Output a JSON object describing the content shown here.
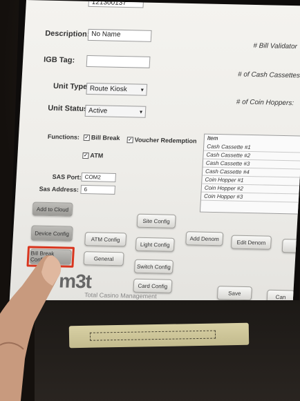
{
  "form": {
    "unit_id_value": "121300137",
    "description_label": "Description:",
    "description_value": "No Name",
    "igb_tag_label": "IGB Tag:",
    "unit_type_label": "Unit Type:",
    "unit_type_value": "Route Kiosk",
    "unit_status_label": "Unit Status:",
    "unit_status_value": "Active",
    "functions_label": "Functions:",
    "bill_break_label": "Bill Break",
    "voucher_redemption_label": "Voucher Redemption",
    "atm_label": "ATM",
    "sas_port_label": "SAS Port:",
    "sas_port_value": "COM2",
    "sas_address_label": "Sas Address:",
    "sas_address_value": "6"
  },
  "right_panel": {
    "bill_validators_label": "# Bill Validator",
    "cash_cassettes_label": "# of Cash Cassettes:",
    "coin_hoppers_label": "# of Coin Hoppers:"
  },
  "denom_list": {
    "header": "Item",
    "items": [
      "Cash Cassette #1",
      "Cash Cassette #2",
      "Cash Cassette #3",
      "Cash Cassette #4",
      "Coin Hopper #1",
      "Coin Hopper #2",
      "Coin Hopper #3"
    ]
  },
  "buttons": {
    "add_to_cloud": "Add to Cloud",
    "site_config": "Site Config",
    "device_config": "Device Config",
    "atm_config": "ATM Config",
    "light_config": "Light Config",
    "add_denom": "Add Denom",
    "edit_denom": "Edit Denom",
    "bill_break_config": "Bill Break Config",
    "general": "General",
    "switch_config": "Switch Config",
    "card_config": "Card Config",
    "save": "Save",
    "cancel_partial": "Can"
  },
  "branding": {
    "logo": "m3t",
    "tagline": "Total Casino Management"
  },
  "colors": {
    "highlight": "#d9361f",
    "screen_bg": "#f0efeb",
    "button_dark": "#a8a7a3"
  }
}
